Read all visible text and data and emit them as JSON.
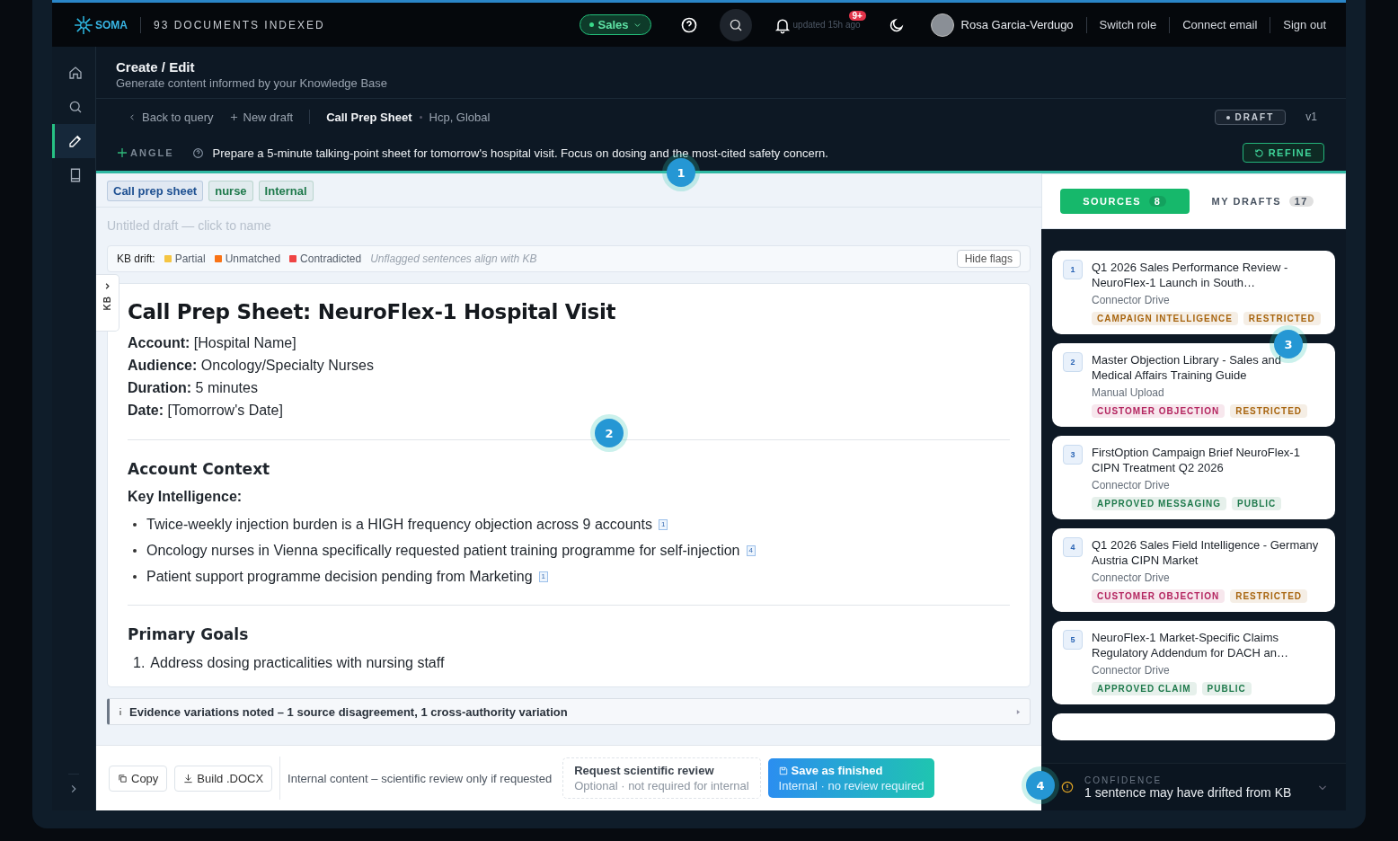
{
  "topbar": {
    "logo": "SOMA",
    "indexed": "93 DOCUMENTS INDEXED",
    "role": "Sales",
    "notification_text": "updated 15h ago",
    "notification_badge": "9+",
    "user": "Rosa Garcia-Verdugo",
    "links": [
      "Switch role",
      "Connect email",
      "Sign out"
    ]
  },
  "nav": [
    {
      "kind": "home",
      "selected": false
    },
    {
      "kind": "search",
      "selected": false
    },
    {
      "kind": "edit",
      "selected": true
    },
    {
      "kind": "book",
      "selected": false
    }
  ],
  "header": {
    "title": "Create / Edit",
    "subtitle": "Generate content informed by your Knowledge Base"
  },
  "toolbar": {
    "back": "Back to query",
    "new_draft": "New draft",
    "doc_type": "Call Prep Sheet",
    "audience": "Hcp, Global",
    "status": "DRAFT",
    "version": "v1"
  },
  "angle": {
    "label": "ANGLE",
    "prompt": "Prepare a 5-minute talking-point sheet for tomorrow's hospital visit. Focus on dosing and the most-cited safety concern.",
    "button": "REFINE"
  },
  "tags": [
    {
      "label": "Call prep sheet",
      "color": "#1d4f91"
    },
    {
      "label": "nurse",
      "color": "#1f7a4c"
    },
    {
      "label": "Internal",
      "color": "#1f7a4c"
    }
  ],
  "draft_name_placeholder": "Untitled draft — click to name",
  "kb_drift": {
    "label": "KB drift:",
    "legend": [
      {
        "label": "Partial",
        "color": "#f5c542"
      },
      {
        "label": "Unmatched",
        "color": "#f97316"
      },
      {
        "label": "Contradicted",
        "color": "#ef4444"
      }
    ],
    "note": "Unflagged sentences align with KB",
    "button": "Hide flags"
  },
  "kb_tab": "KB",
  "document": {
    "title": "Call Prep Sheet: NeuroFlex-1 Hospital Visit",
    "blocks": [
      {
        "kind": "field",
        "label": "Account:",
        "text": "[Hospital Name]"
      },
      {
        "kind": "field",
        "label": "Audience:",
        "text": "Oncology/Specialty Nurses"
      },
      {
        "kind": "field",
        "label": "Duration:",
        "text": "5 minutes"
      },
      {
        "kind": "field",
        "label": "Date:",
        "text": "[Tomorrow's Date]"
      },
      {
        "kind": "rule"
      },
      {
        "kind": "heading",
        "text": "Account Context"
      },
      {
        "kind": "subheading",
        "text": "Key Intelligence:"
      },
      {
        "kind": "bullet",
        "text": "Twice-weekly injection burden is a HIGH frequency objection across 9 accounts",
        "ref": "1"
      },
      {
        "kind": "bullet",
        "text": "Oncology nurses in Vienna specifically requested patient training programme for self-injection",
        "ref": "4"
      },
      {
        "kind": "bullet",
        "text": "Patient support programme decision pending from Marketing",
        "ref": "1"
      },
      {
        "kind": "rule"
      },
      {
        "kind": "heading",
        "text": "Primary Goals"
      },
      {
        "kind": "numbered",
        "label": "1.",
        "text": "Address dosing practicalities with nursing staff"
      }
    ]
  },
  "evidence": "Evidence variations noted – 1 source disagreement, 1 cross-authority variation",
  "footer": {
    "copy": "Copy",
    "build": "Build .DOCX",
    "note": "Internal content – scientific review only if requested",
    "review_title": "Request scientific review",
    "review_subtitle": "Optional · not required for internal",
    "save_title": "Save as finished",
    "save_subtitle": "Internal · no review required"
  },
  "panel_tabs": [
    {
      "label": "SOURCES",
      "count": "8",
      "selected": true
    },
    {
      "label": "MY DRAFTS",
      "count": "17",
      "selected": false
    }
  ],
  "sources": [
    {
      "number": "1",
      "title": "Q1 2026 Sales Performance Review - NeuroFlex-1 Launch in South…",
      "origin": "Connector Drive",
      "tags": [
        {
          "label": "CAMPAIGN INTELLIGENCE",
          "color": "#a8650f"
        },
        {
          "label": "RESTRICTED",
          "color": "#a8650f"
        }
      ]
    },
    {
      "number": "2",
      "title": "Master Objection Library - Sales and Medical Affairs Training Guide",
      "origin": "Manual Upload",
      "tags": [
        {
          "label": "CUSTOMER OBJECTION",
          "color": "#b3245f"
        },
        {
          "label": "RESTRICTED",
          "color": "#a8650f"
        }
      ]
    },
    {
      "number": "3",
      "title": "FirstOption Campaign Brief NeuroFlex-1 CIPN Treatment Q2 2026",
      "origin": "Connector Drive",
      "tags": [
        {
          "label": "APPROVED MESSAGING",
          "color": "#1f7a4c"
        },
        {
          "label": "PUBLIC",
          "color": "#1f7a4c"
        }
      ]
    },
    {
      "number": "4",
      "title": "Q1 2026 Sales Field Intelligence - Germany Austria CIPN Market",
      "origin": "Connector Drive",
      "tags": [
        {
          "label": "CUSTOMER OBJECTION",
          "color": "#b3245f"
        },
        {
          "label": "RESTRICTED",
          "color": "#a8650f"
        }
      ]
    },
    {
      "number": "5",
      "title": "NeuroFlex-1 Market-Specific Claims Regulatory Addendum for DACH an…",
      "origin": "Connector Drive",
      "tags": [
        {
          "label": "APPROVED CLAIM",
          "color": "#1f7a4c"
        },
        {
          "label": "PUBLIC",
          "color": "#1f7a4c"
        }
      ]
    }
  ],
  "confidence": {
    "label": "CONFIDENCE",
    "message": "1 sentence may have drifted from KB"
  },
  "tour_steps": [
    "1",
    "2",
    "3",
    "4"
  ]
}
